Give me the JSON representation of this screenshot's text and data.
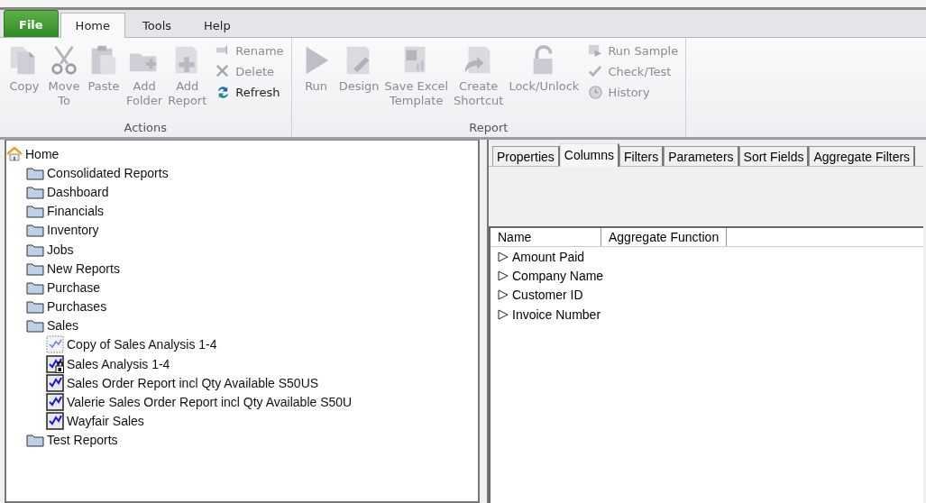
{
  "menu_tabs": [
    {
      "label": "File",
      "kind": "file",
      "selected": false
    },
    {
      "label": "Home",
      "kind": "tab",
      "selected": true
    },
    {
      "label": "Tools",
      "kind": "tab",
      "selected": false
    },
    {
      "label": "Help",
      "kind": "tab",
      "selected": false
    }
  ],
  "ribbon_groups": [
    {
      "title": "Actions",
      "large_buttons": [
        {
          "label": "Copy",
          "disabled": true
        },
        {
          "label": "Move\nTo",
          "disabled": true
        },
        {
          "label": "Paste",
          "disabled": true
        },
        {
          "label": "Add\nFolder",
          "disabled": true
        },
        {
          "label": "Add\nReport",
          "disabled": true
        }
      ],
      "small_buttons": [
        {
          "label": "Rename",
          "disabled": true
        },
        {
          "label": "Delete",
          "disabled": true
        },
        {
          "label": "Refresh",
          "disabled": false
        }
      ]
    },
    {
      "title": "Report",
      "large_buttons": [
        {
          "label": "Run",
          "disabled": true
        },
        {
          "label": "Design",
          "disabled": true
        },
        {
          "label": "Save Excel\nTemplate",
          "disabled": true
        },
        {
          "label": "Create\nShortcut",
          "disabled": true
        },
        {
          "label": "Lock/Unlock",
          "disabled": true
        }
      ],
      "small_buttons": [
        {
          "label": "Run Sample",
          "disabled": true
        },
        {
          "label": "Check/Test",
          "disabled": true
        },
        {
          "label": "History",
          "disabled": true
        }
      ]
    }
  ],
  "tree": {
    "label": "Home",
    "children": [
      {
        "label": "Consolidated Reports",
        "kind": "folder"
      },
      {
        "label": "Dashboard",
        "kind": "folder"
      },
      {
        "label": "Financials",
        "kind": "folder"
      },
      {
        "label": "Inventory",
        "kind": "folder"
      },
      {
        "label": "Jobs",
        "kind": "folder"
      },
      {
        "label": "New Reports",
        "kind": "folder"
      },
      {
        "label": "Purchase",
        "kind": "folder"
      },
      {
        "label": "Purchases",
        "kind": "folder"
      },
      {
        "label": "Sales",
        "kind": "folder",
        "children": [
          {
            "label": "Copy of Sales Analysis 1-4",
            "kind": "copy"
          },
          {
            "label": "Sales Analysis 1-4",
            "kind": "report",
            "locked": true
          },
          {
            "label": "Sales Order Report incl Qty Available S50US",
            "kind": "report",
            "locked": false
          },
          {
            "label": "Valerie Sales Order Report incl Qty Available S50U",
            "kind": "report",
            "locked": false
          },
          {
            "label": "Wayfair Sales",
            "kind": "report",
            "locked": false
          }
        ]
      },
      {
        "label": "Test Reports",
        "kind": "folder"
      }
    ]
  },
  "detail_tabs": [
    {
      "label": "Properties",
      "selected": false
    },
    {
      "label": "Columns",
      "selected": true
    },
    {
      "label": "Filters",
      "selected": false
    },
    {
      "label": "Parameters",
      "selected": false
    },
    {
      "label": "Sort Fields",
      "selected": false
    },
    {
      "label": "Aggregate Filters",
      "selected": false
    }
  ],
  "table": {
    "columns": [
      "Name",
      "Aggregate Function"
    ],
    "rows": [
      {
        "name": "Amount Paid"
      },
      {
        "name": "Company Name"
      },
      {
        "name": "Customer ID"
      },
      {
        "name": "Invoice Number"
      }
    ]
  }
}
